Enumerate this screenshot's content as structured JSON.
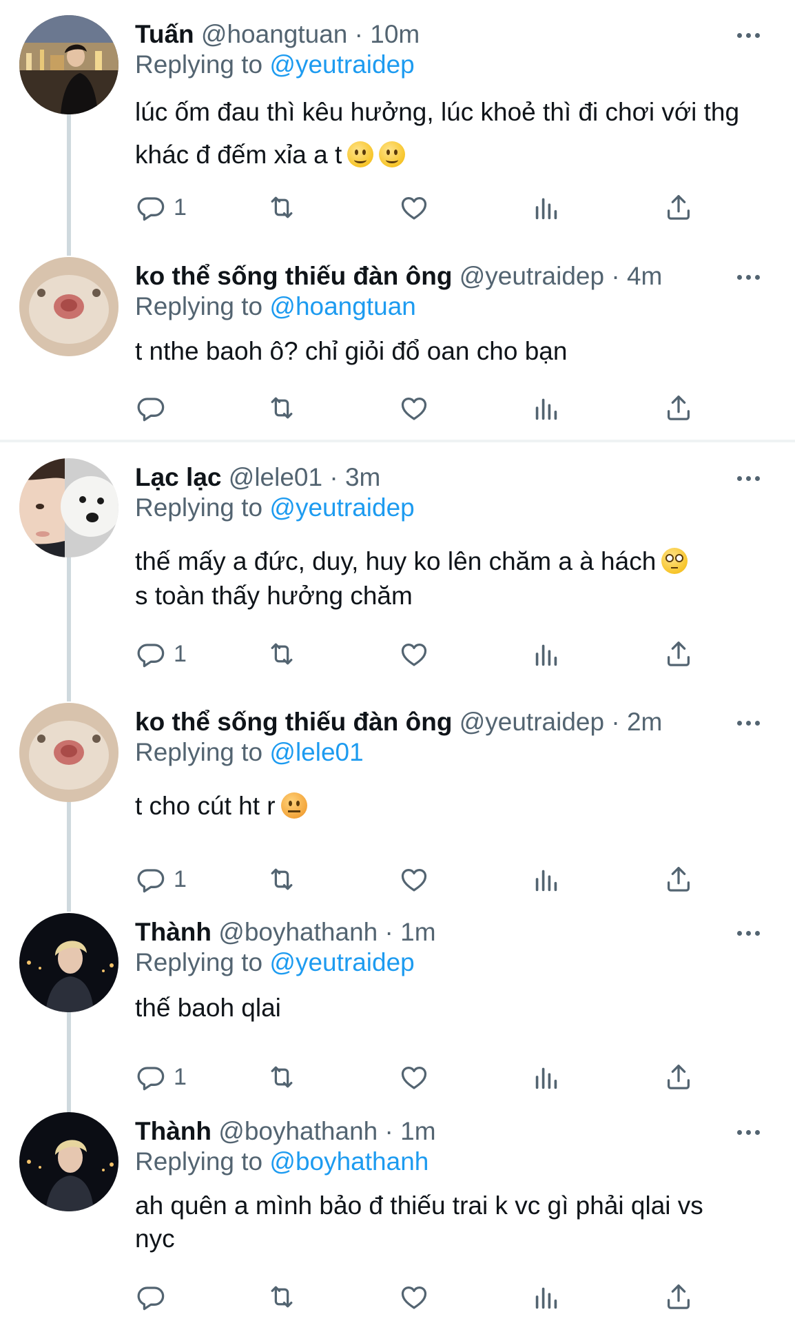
{
  "tweets": [
    {
      "name": "Tuấn",
      "handle": "@hoangtuan",
      "separator": "·",
      "time": "10m",
      "replying_prefix": "Replying to",
      "replying_to": "@yeutraidep",
      "text": "lúc ốm đau thì kêu hưởng, lúc khoẻ thì đi chơi với thg khác đ đếm xỉa a t",
      "emojis": [
        "slightly-smiling-face",
        "slightly-smiling-face"
      ],
      "reply_count": "1",
      "avatar": "person-photo-night-city"
    },
    {
      "name": "ko thể sống thiếu đàn ông",
      "handle": "@yeutraidep",
      "separator": "·",
      "time": "4m",
      "replying_prefix": "Replying to",
      "replying_to": "@hoangtuan",
      "text": "t nthe baoh ô? chỉ giỏi đổ oan cho bạn",
      "emojis": [],
      "reply_count": "",
      "avatar": "hamster-closeup"
    },
    {
      "name": "Lạc lạc",
      "handle": "@lele01",
      "separator": "·",
      "time": "3m",
      "replying_prefix": "Replying to",
      "replying_to": "@yeutraidep",
      "text_line1": "thế mấy a đức, duy, huy ko lên chăm a à hách",
      "text_line2": "s toàn thấy hưởng chăm",
      "emojis": [
        "face-with-rolling-eyes"
      ],
      "reply_count": "1",
      "avatar": "person-with-white-dog"
    },
    {
      "name": "ko thể sống thiếu đàn ông",
      "handle": "@yeutraidep",
      "separator": "·",
      "time": "2m",
      "replying_prefix": "Replying to",
      "replying_to": "@lele01",
      "text": "t cho cút ht r",
      "emojis": [
        "pouting-face"
      ],
      "reply_count": "1",
      "avatar": "hamster-closeup"
    },
    {
      "name": "Thành",
      "handle": "@boyhathanh",
      "separator": "·",
      "time": "1m",
      "replying_prefix": "Replying to",
      "replying_to": "@yeutraidep",
      "text": "thế baoh qlai",
      "emojis": [],
      "reply_count": "1",
      "avatar": "blond-person-night"
    },
    {
      "name": "Thành",
      "handle": "@boyhathanh",
      "separator": "·",
      "time": "1m",
      "replying_prefix": "Replying to",
      "replying_to": "@boyhathanh",
      "text_line1": "ah quên a mình bảo đ thiếu trai k vc gì phải qlai vs",
      "text_line2": "nyc",
      "emojis": [],
      "reply_count": "",
      "avatar": "blond-person-night"
    }
  ],
  "icons": {
    "reply": "reply-icon",
    "retweet": "retweet-icon",
    "like": "heart-icon",
    "views": "views-icon",
    "share": "share-icon",
    "more": "more-icon"
  },
  "colors": {
    "text": "#0f1419",
    "secondary": "#536471",
    "mention": "#1d9bf0",
    "thread_line": "#cfd9de",
    "separator": "#eff3f4"
  }
}
